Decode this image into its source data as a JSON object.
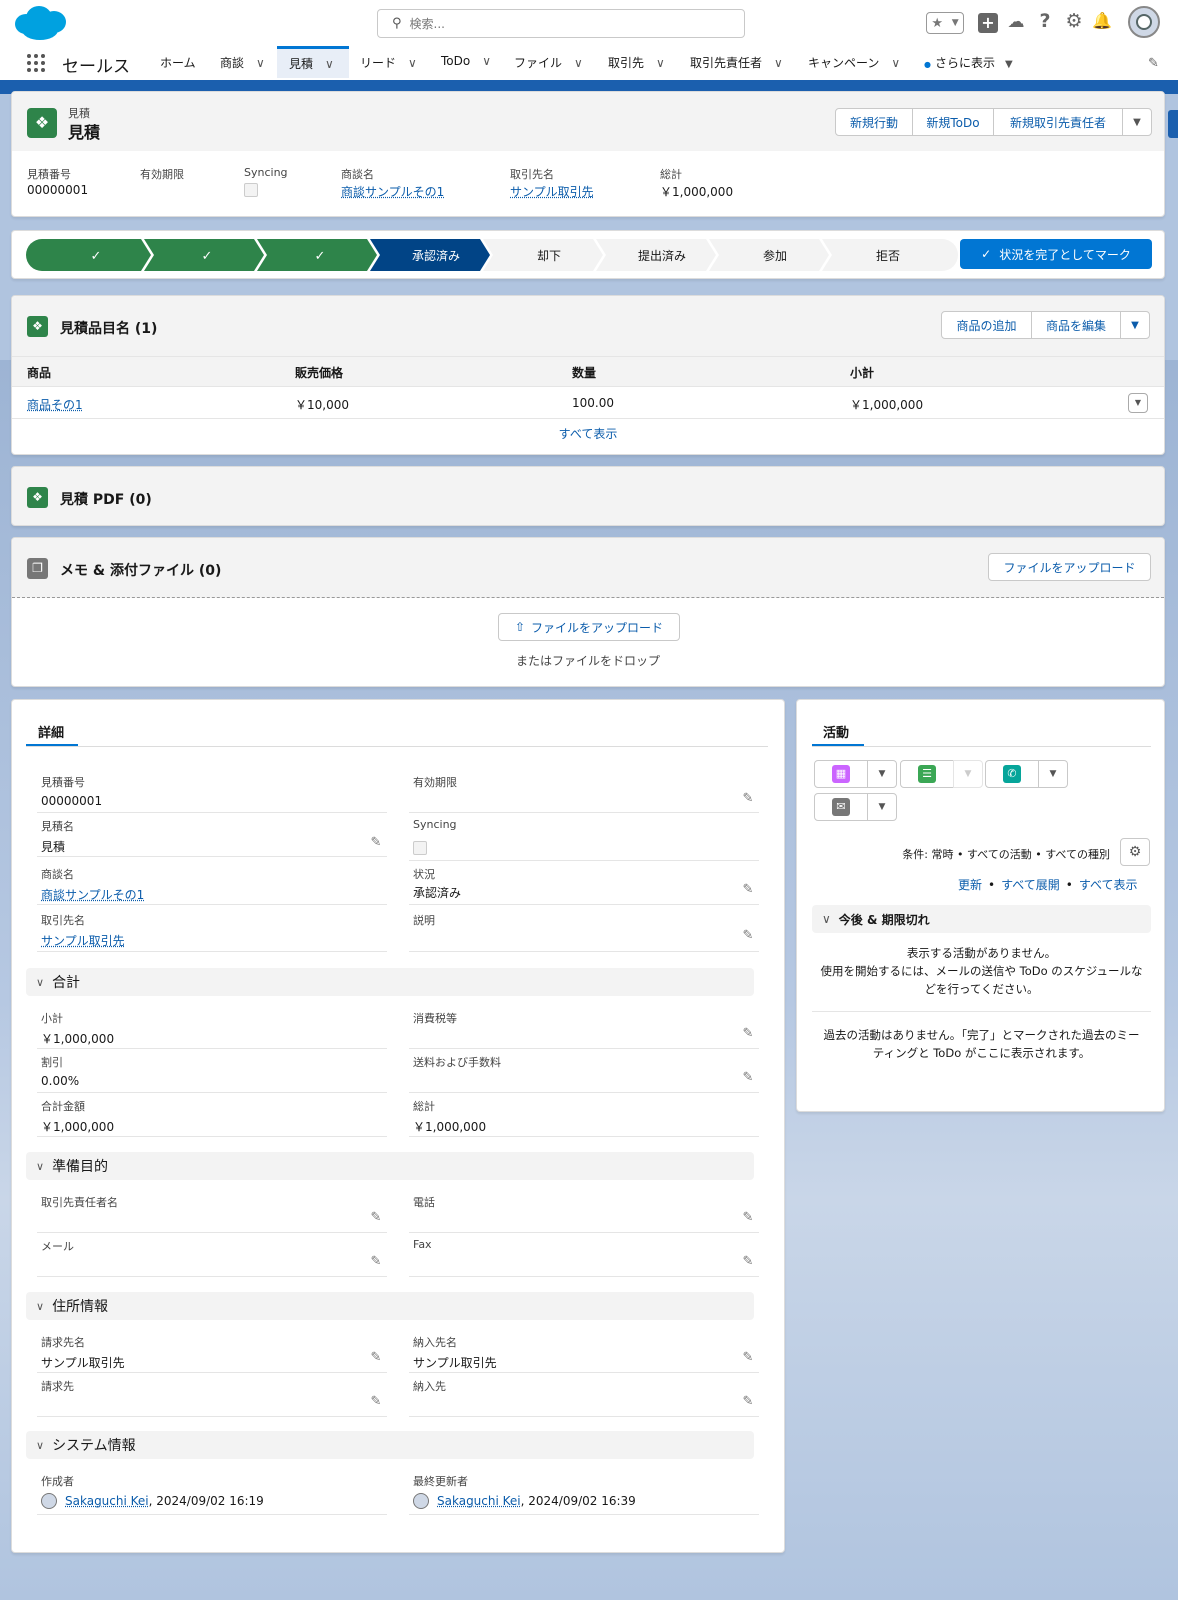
{
  "nav": {
    "search_placeholder": "検索...",
    "app_name": "セールス",
    "tabs": [
      "ホーム",
      "商談",
      "見積",
      "リード",
      "ToDo",
      "ファイル",
      "取引先",
      "取引先責任者",
      "キャンペーン",
      "さらに表示"
    ]
  },
  "record": {
    "type_label": "見積",
    "title": "見積",
    "actions": [
      "新規行動",
      "新規ToDo",
      "新規取引先責任者"
    ],
    "highlights": [
      {
        "label": "見積番号",
        "value": "00000001"
      },
      {
        "label": "有効期限",
        "value": ""
      },
      {
        "label": "Syncing",
        "value": ""
      },
      {
        "label": "商談名",
        "value": "商談サンプルその1"
      },
      {
        "label": "取引先名",
        "value": "サンプル取引先"
      },
      {
        "label": "総計",
        "value": "￥1,000,000"
      }
    ]
  },
  "path": {
    "stages": [
      "承認済み",
      "却下",
      "提出済み",
      "参加",
      "拒否"
    ],
    "mark_button": "状況を完了としてマーク"
  },
  "line_items": {
    "title": "見積品目名 (1)",
    "add_button": "商品の追加",
    "edit_button": "商品を編集",
    "columns": [
      "商品",
      "販売価格",
      "数量",
      "小計"
    ],
    "rows": [
      [
        "商品その1",
        "￥10,000",
        "100.00",
        "￥1,000,000"
      ]
    ],
    "view_all": "すべて表示"
  },
  "pdf": {
    "title": "見積 PDF (0)"
  },
  "files": {
    "title": "メモ & 添付ファイル (0)",
    "upload_button": "ファイルをアップロード",
    "upload_center": "ファイルをアップロード",
    "drop_text": "またはファイルをドロップ"
  },
  "details": {
    "tab": "詳細",
    "fields": {
      "quote_number_label": "見積番号",
      "quote_number": "00000001",
      "expiry_label": "有効期限",
      "quote_name_label": "見積名",
      "quote_name": "見積",
      "syncing_label": "Syncing",
      "opp_label": "商談名",
      "opp": "商談サンプルその1",
      "status_label": "状況",
      "status": "承認済み",
      "account_label": "取引先名",
      "account": "サンプル取引先",
      "desc_label": "説明"
    },
    "totals_header": "合計",
    "totals": {
      "subtotal_label": "小計",
      "subtotal": "￥1,000,000",
      "tax_label": "消費税等",
      "discount_label": "割引",
      "discount": "0.00%",
      "shipping_label": "送料および手数料",
      "total_price_label": "合計金額",
      "total_price": "￥1,000,000",
      "grand_total_label": "総計",
      "grand_total": "￥1,000,000"
    },
    "prepared_header": "準備目的",
    "prepared": {
      "contact_label": "取引先責任者名",
      "phone_label": "電話",
      "email_label": "メール",
      "fax_label": "Fax"
    },
    "address_header": "住所情報",
    "address": {
      "bill_name_label": "請求先名",
      "bill_name": "サンプル取引先",
      "ship_name_label": "納入先名",
      "ship_name": "サンプル取引先",
      "bill_label": "請求先",
      "ship_label": "納入先"
    },
    "system_header": "システム情報",
    "system": {
      "created_label": "作成者",
      "created_user": "Sakaguchi Kei",
      "created_date": ", 2024/09/02 16:19",
      "modified_label": "最終更新者",
      "modified_user": "Sakaguchi Kei",
      "modified_date": ", 2024/09/02 16:39"
    }
  },
  "activity": {
    "tab": "活動",
    "filter": "条件: 常時 • すべての活動 • すべての種別",
    "refresh": "更新",
    "expand_all": "すべて展開",
    "show_all": "すべて表示",
    "upcoming_header": "今後 & 期限切れ",
    "upcoming_empty_1": "表示する活動がありません。",
    "upcoming_empty_2": "使用を開始するには、メールの送信や ToDo のスケジュールな",
    "upcoming_empty_3": "どを行ってください。",
    "past_1": "過去の活動はありません。「完了」とマークされた過去のミー",
    "past_2": "ティングと ToDo がここに表示されます。"
  },
  "colors": {
    "brand": "#0176d3",
    "path_done": "#2e844a",
    "path_current": "#014486",
    "record_icon": "#2e844a"
  }
}
